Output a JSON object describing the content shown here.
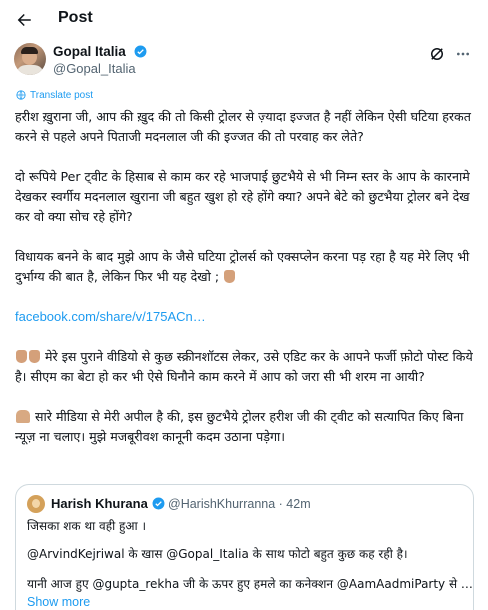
{
  "header": {
    "title": "Post"
  },
  "author": {
    "name": "Gopal Italia",
    "handle": "@Gopal_Italia"
  },
  "translate": {
    "label": "Translate post"
  },
  "tweet": {
    "para1": "हरीश ख़ुराना जी, आप की ख़ुद की तो किसी ट्रोलर से ज़्यादा इज्जत है नहीं लेकिन ऐसी घटिया हरकत करने से पहले अपने पिताजी मदनलाल जी की इज्जत की तो परवाह कर लेते?",
    "para2": "दो रूपिये Per ट्वीट के हिसाब से काम कर रहे भाजपाई छुटभैये से भी निम्न स्तर के आप के कारनामे देखकर स्वर्गीय मदनलाल खुराना जी बहुत खुश हो रहे होंगे क्या? अपने बेटे को छुटभैया ट्रोलर बने देख कर वो क्या सोच रहे होंगे?",
    "para3": "विधायक बनने के बाद मुझे आप के जैसे घटिया ट्रोलर्स को एक्सप्लेन करना पड़ रहा है यह मेरे लिए भी दुर्भाग्य की बात है, लेकिन फिर भी यह देखो ;",
    "link": "facebook.com/share/v/175ACn…",
    "para4": "मेरे इस पुराने वीडियो से कुछ स्क्रीनशॉटस लेकर, उसे एडिट कर के आपने फर्जी फ़ोटो पोस्ट किये है। सीएम का बेटा हो कर भी ऐसे घिनौने काम करने में आप को जरा सी भी शरम ना आयी?",
    "para5": "सारे मीडिया से मेरी अपील है की, इस छुटभैये ट्रोलर हरीश जी की ट्वीट को सत्यापित किए बिना न्यूज़ ना चलाए। मुझे मजबूरीवश कानूनी कदम उठाना पड़ेगा।"
  },
  "quote": {
    "name": "Harish Khurana",
    "handle_time": "@HarishKhurranna · 42m",
    "line1": "जिसका शक था वही हुआ ।",
    "line2": "@ArvindKejriwal के खास @Gopal_Italia के साथ फोटो बहुत कुछ कह रही है।",
    "line3": "यानी आज हुए @gupta_rekha जी के ऊपर हुए हमले का कनेक्शन @AamAadmiParty से …",
    "show_more": "Show more"
  },
  "icons": {
    "back": "arrow-left-icon",
    "verified": "verified-badge-icon",
    "grok": "grok-icon",
    "more": "more-horizontal-icon",
    "translate": "globe-icon",
    "hand_down": "backhand-index-pointing-down-emoji",
    "hands_pray": "folded-hands-emoji"
  },
  "colors": {
    "accent": "#1d9bf0",
    "text": "#0f1419",
    "secondary": "#536471",
    "border": "#cfd9de"
  }
}
